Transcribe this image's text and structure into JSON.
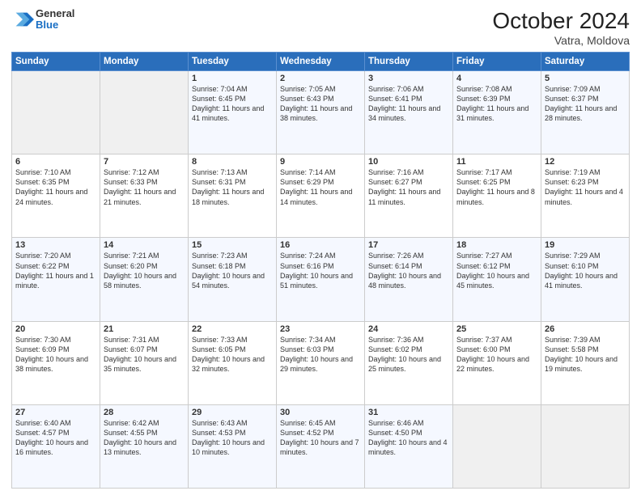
{
  "header": {
    "logo": {
      "general": "General",
      "blue": "Blue"
    },
    "title": "October 2024",
    "subtitle": "Vatra, Moldova"
  },
  "days_of_week": [
    "Sunday",
    "Monday",
    "Tuesday",
    "Wednesday",
    "Thursday",
    "Friday",
    "Saturday"
  ],
  "weeks": [
    [
      {
        "day": "",
        "info": ""
      },
      {
        "day": "",
        "info": ""
      },
      {
        "day": "1",
        "info": "Sunrise: 7:04 AM\nSunset: 6:45 PM\nDaylight: 11 hours and 41 minutes."
      },
      {
        "day": "2",
        "info": "Sunrise: 7:05 AM\nSunset: 6:43 PM\nDaylight: 11 hours and 38 minutes."
      },
      {
        "day": "3",
        "info": "Sunrise: 7:06 AM\nSunset: 6:41 PM\nDaylight: 11 hours and 34 minutes."
      },
      {
        "day": "4",
        "info": "Sunrise: 7:08 AM\nSunset: 6:39 PM\nDaylight: 11 hours and 31 minutes."
      },
      {
        "day": "5",
        "info": "Sunrise: 7:09 AM\nSunset: 6:37 PM\nDaylight: 11 hours and 28 minutes."
      }
    ],
    [
      {
        "day": "6",
        "info": "Sunrise: 7:10 AM\nSunset: 6:35 PM\nDaylight: 11 hours and 24 minutes."
      },
      {
        "day": "7",
        "info": "Sunrise: 7:12 AM\nSunset: 6:33 PM\nDaylight: 11 hours and 21 minutes."
      },
      {
        "day": "8",
        "info": "Sunrise: 7:13 AM\nSunset: 6:31 PM\nDaylight: 11 hours and 18 minutes."
      },
      {
        "day": "9",
        "info": "Sunrise: 7:14 AM\nSunset: 6:29 PM\nDaylight: 11 hours and 14 minutes."
      },
      {
        "day": "10",
        "info": "Sunrise: 7:16 AM\nSunset: 6:27 PM\nDaylight: 11 hours and 11 minutes."
      },
      {
        "day": "11",
        "info": "Sunrise: 7:17 AM\nSunset: 6:25 PM\nDaylight: 11 hours and 8 minutes."
      },
      {
        "day": "12",
        "info": "Sunrise: 7:19 AM\nSunset: 6:23 PM\nDaylight: 11 hours and 4 minutes."
      }
    ],
    [
      {
        "day": "13",
        "info": "Sunrise: 7:20 AM\nSunset: 6:22 PM\nDaylight: 11 hours and 1 minute."
      },
      {
        "day": "14",
        "info": "Sunrise: 7:21 AM\nSunset: 6:20 PM\nDaylight: 10 hours and 58 minutes."
      },
      {
        "day": "15",
        "info": "Sunrise: 7:23 AM\nSunset: 6:18 PM\nDaylight: 10 hours and 54 minutes."
      },
      {
        "day": "16",
        "info": "Sunrise: 7:24 AM\nSunset: 6:16 PM\nDaylight: 10 hours and 51 minutes."
      },
      {
        "day": "17",
        "info": "Sunrise: 7:26 AM\nSunset: 6:14 PM\nDaylight: 10 hours and 48 minutes."
      },
      {
        "day": "18",
        "info": "Sunrise: 7:27 AM\nSunset: 6:12 PM\nDaylight: 10 hours and 45 minutes."
      },
      {
        "day": "19",
        "info": "Sunrise: 7:29 AM\nSunset: 6:10 PM\nDaylight: 10 hours and 41 minutes."
      }
    ],
    [
      {
        "day": "20",
        "info": "Sunrise: 7:30 AM\nSunset: 6:09 PM\nDaylight: 10 hours and 38 minutes."
      },
      {
        "day": "21",
        "info": "Sunrise: 7:31 AM\nSunset: 6:07 PM\nDaylight: 10 hours and 35 minutes."
      },
      {
        "day": "22",
        "info": "Sunrise: 7:33 AM\nSunset: 6:05 PM\nDaylight: 10 hours and 32 minutes."
      },
      {
        "day": "23",
        "info": "Sunrise: 7:34 AM\nSunset: 6:03 PM\nDaylight: 10 hours and 29 minutes."
      },
      {
        "day": "24",
        "info": "Sunrise: 7:36 AM\nSunset: 6:02 PM\nDaylight: 10 hours and 25 minutes."
      },
      {
        "day": "25",
        "info": "Sunrise: 7:37 AM\nSunset: 6:00 PM\nDaylight: 10 hours and 22 minutes."
      },
      {
        "day": "26",
        "info": "Sunrise: 7:39 AM\nSunset: 5:58 PM\nDaylight: 10 hours and 19 minutes."
      }
    ],
    [
      {
        "day": "27",
        "info": "Sunrise: 6:40 AM\nSunset: 4:57 PM\nDaylight: 10 hours and 16 minutes."
      },
      {
        "day": "28",
        "info": "Sunrise: 6:42 AM\nSunset: 4:55 PM\nDaylight: 10 hours and 13 minutes."
      },
      {
        "day": "29",
        "info": "Sunrise: 6:43 AM\nSunset: 4:53 PM\nDaylight: 10 hours and 10 minutes."
      },
      {
        "day": "30",
        "info": "Sunrise: 6:45 AM\nSunset: 4:52 PM\nDaylight: 10 hours and 7 minutes."
      },
      {
        "day": "31",
        "info": "Sunrise: 6:46 AM\nSunset: 4:50 PM\nDaylight: 10 hours and 4 minutes."
      },
      {
        "day": "",
        "info": ""
      },
      {
        "day": "",
        "info": ""
      }
    ]
  ]
}
